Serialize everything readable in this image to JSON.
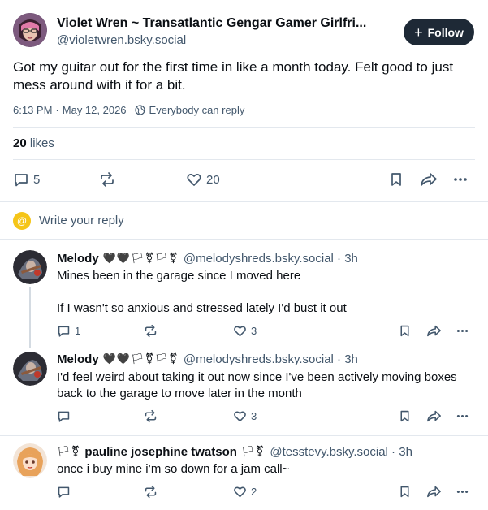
{
  "post": {
    "author_name": "Violet Wren ~ Transatlantic Gengar Gamer Girlfri...",
    "author_handle": "@violetwren.bsky.social",
    "follow_label": "Follow",
    "text": "Got my guitar out for the first time in like a month today. Felt good to just mess around with it for a bit.",
    "time": "6:13 PM",
    "date": "May 12, 2026",
    "reply_setting": "Everybody can reply",
    "likes_count": "20",
    "likes_label": "likes",
    "reply_count": "5",
    "like_count": "20"
  },
  "composer": {
    "placeholder": "Write your reply"
  },
  "replies": [
    {
      "name": "Melody",
      "emoji": "🖤🖤🏳⚧🏳⚧",
      "handle": "@melodyshreds.bsky.social · 3h",
      "text1": "Mines been in the garage since I moved here",
      "text2": "If I wasn't so anxious and stressed lately I'd bust it out",
      "reply_count": "1",
      "like_count": "3"
    },
    {
      "name": "Melody",
      "emoji": "🖤🖤🏳⚧🏳⚧",
      "handle": "@melodyshreds.bsky.social · 3h",
      "text1": "I'd feel weird about taking it out now since I've been actively moving boxes back to the garage to move later in the month",
      "reply_count": "",
      "like_count": "3"
    },
    {
      "name": "pauline josephine twatson",
      "emoji_before": "🏳⚧",
      "emoji": "🏳⚧",
      "handle": "@tesstevy.bsky.social · 3h",
      "text1": "once i buy mine i’m so down for a jam call~",
      "reply_count": "",
      "like_count": "2"
    }
  ],
  "colors": {
    "text": "#0b0f14",
    "muted": "#42576c",
    "border": "#e3e8ee",
    "follow_bg": "#1e2936",
    "composer_avatar": "#f5c518"
  }
}
